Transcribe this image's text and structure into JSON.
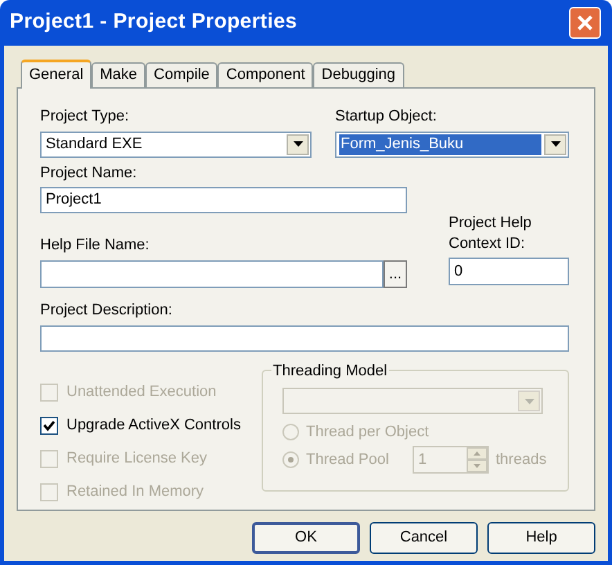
{
  "window": {
    "title": "Project1 - Project Properties"
  },
  "tabs": [
    {
      "label": "General",
      "selected": true
    },
    {
      "label": "Make",
      "selected": false
    },
    {
      "label": "Compile",
      "selected": false
    },
    {
      "label": "Component",
      "selected": false
    },
    {
      "label": "Debugging",
      "selected": false
    }
  ],
  "project_type": {
    "label": "Project Type:",
    "value": "Standard EXE"
  },
  "startup_object": {
    "label": "Startup Object:",
    "value": "Form_Jenis_Buku",
    "selected": true
  },
  "project_name": {
    "label": "Project Name:",
    "value": "Project1"
  },
  "help_file_name": {
    "label": "Help File Name:",
    "browse_button": "..."
  },
  "help_context_id": {
    "label": "Project Help Context ID:",
    "value": "0"
  },
  "project_description": {
    "label": "Project Description:"
  },
  "options": [
    {
      "label": "Unattended Execution",
      "checked": false,
      "disabled": true
    },
    {
      "label": "Upgrade ActiveX Controls",
      "checked": true,
      "disabled": false
    },
    {
      "label": "Require License Key",
      "checked": false,
      "disabled": true
    },
    {
      "label": "Retained In Memory",
      "checked": false,
      "disabled": true
    }
  ],
  "threading_model": {
    "title": "Threading Model",
    "disabled": true,
    "options": [
      {
        "label": "Thread per Object",
        "selected": false
      },
      {
        "label": "Thread Pool",
        "selected": true
      }
    ],
    "thread_count": "1",
    "unit": "threads"
  },
  "buttons": [
    "OK",
    "Cancel",
    "Help"
  ]
}
